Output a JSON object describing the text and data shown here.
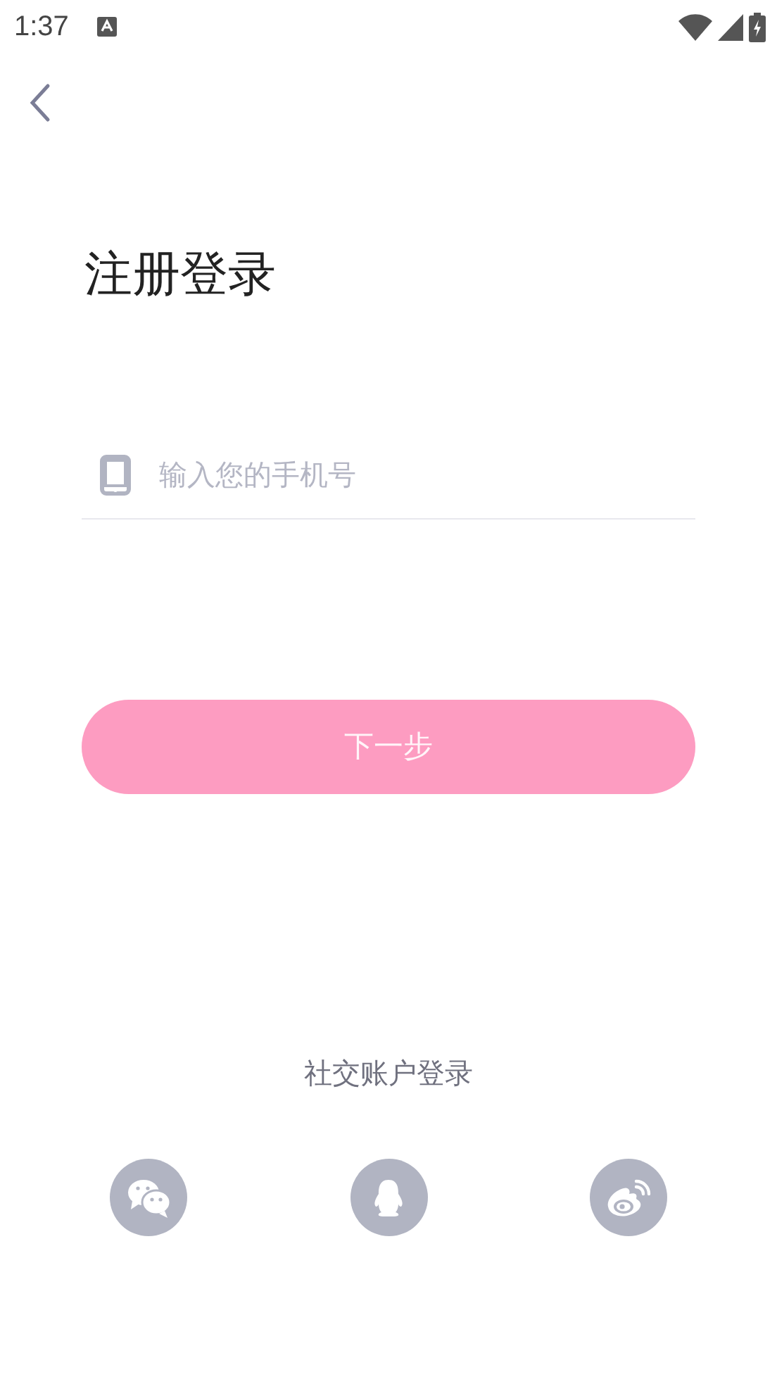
{
  "status_bar": {
    "time": "1:37"
  },
  "title": "注册登录",
  "phone_field": {
    "placeholder": "输入您的手机号"
  },
  "next_button": {
    "label": "下一步",
    "disabled": true
  },
  "social_login": {
    "label": "社交账户登录",
    "providers": [
      {
        "kind": "chat"
      },
      {
        "kind": "penguin"
      },
      {
        "kind": "weibo"
      }
    ]
  }
}
